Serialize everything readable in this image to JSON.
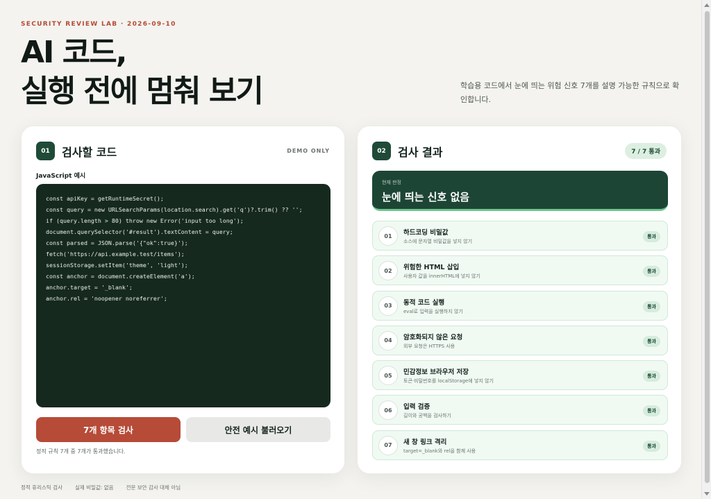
{
  "eyebrow": "SECURITY REVIEW LAB · 2026-09-10",
  "hero": {
    "line1": "AI 코드,",
    "line2": "실행 전에 멈춰 보기"
  },
  "intro": "학습용 코드에서 눈에 띄는 위험 신호 7개를 설명 가능한 규칙으로 확인합니다.",
  "left_panel": {
    "badge": "01",
    "title": "검사할 코드",
    "tag": "DEMO ONLY",
    "code_label": "JavaScript 예시",
    "code_lines": [
      "const apiKey = getRuntimeSecret();",
      "const query = new URLSearchParams(location.search).get('q')?.trim() ?? '';",
      "if (query.length > 80) throw new Error('input too long');",
      "document.querySelector('#result').textContent = query;",
      "const parsed = JSON.parse('{\"ok\":true}');",
      "fetch('https://api.example.test/items');",
      "sessionStorage.setItem('theme', 'light');",
      "const anchor = document.createElement('a');",
      "anchor.target = '_blank';",
      "anchor.rel = 'noopener noreferrer';"
    ],
    "primary_button": "7개 항목 검사",
    "secondary_button": "안전 예시 불러오기",
    "status": "정적 규칙 7개 중 7개가 통과했습니다."
  },
  "right_panel": {
    "badge": "02",
    "title": "검사 결과",
    "pass_count": "7 / 7 통과",
    "verdict_label": "현재 판정",
    "verdict": "눈에 띄는 신호 없음",
    "checks": [
      {
        "num": "01",
        "title": "하드코딩 비밀값",
        "desc": "소스에 문자열 비밀값을 넣지 않기",
        "status": "통과"
      },
      {
        "num": "02",
        "title": "위험한 HTML 삽입",
        "desc": "사용자 값을 innerHTML에 넣지 않기",
        "status": "통과"
      },
      {
        "num": "03",
        "title": "동적 코드 실행",
        "desc": "eval로 입력을 실행하지 않기",
        "status": "통과"
      },
      {
        "num": "04",
        "title": "암호화되지 않은 요청",
        "desc": "외부 요청은 HTTPS 사용",
        "status": "통과"
      },
      {
        "num": "05",
        "title": "민감정보 브라우저 저장",
        "desc": "토큰·비밀번호를 localStorage에 넣지 않기",
        "status": "통과"
      },
      {
        "num": "06",
        "title": "입력 검증",
        "desc": "길이와 공백을 검사하기",
        "status": "통과"
      },
      {
        "num": "07",
        "title": "새 창 링크 격리",
        "desc": "target=_blank와 rel을 함께 사용",
        "status": "통과"
      }
    ]
  },
  "footer": [
    "정적 휴리스틱 검사",
    "실제 비밀값: 없음",
    "전문 보안 감사 대체 아님"
  ]
}
